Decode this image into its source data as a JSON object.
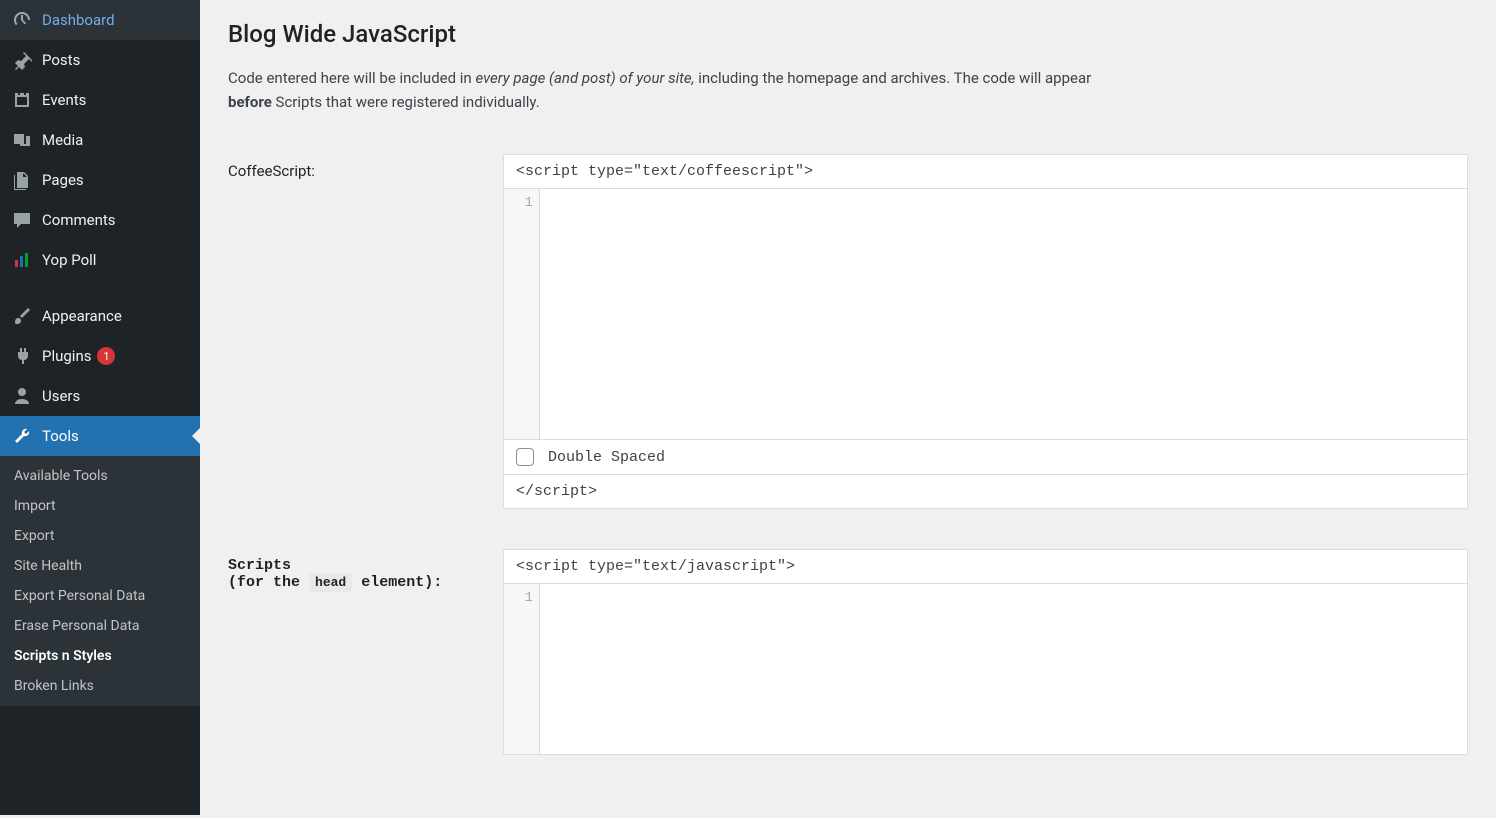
{
  "sidebar": {
    "items": [
      {
        "label": "Dashboard",
        "icon": "dashboard"
      },
      {
        "label": "Posts",
        "icon": "pin"
      },
      {
        "label": "Events",
        "icon": "calendar"
      },
      {
        "label": "Media",
        "icon": "media"
      },
      {
        "label": "Pages",
        "icon": "pages"
      },
      {
        "label": "Comments",
        "icon": "comment"
      },
      {
        "label": "Yop Poll",
        "icon": "bars"
      },
      {
        "label": "Appearance",
        "icon": "brush"
      },
      {
        "label": "Plugins",
        "icon": "plug",
        "badge": "1"
      },
      {
        "label": "Users",
        "icon": "user"
      },
      {
        "label": "Tools",
        "icon": "wrench",
        "active": true
      }
    ],
    "submenu": [
      {
        "label": "Available Tools"
      },
      {
        "label": "Import"
      },
      {
        "label": "Export"
      },
      {
        "label": "Site Health"
      },
      {
        "label": "Export Personal Data"
      },
      {
        "label": "Erase Personal Data"
      },
      {
        "label": "Scripts n Styles",
        "current": true
      },
      {
        "label": "Broken Links"
      }
    ]
  },
  "page": {
    "title": "Blog Wide JavaScript",
    "desc_pre": "Code entered here will be included in ",
    "desc_em": "every page (and post) of your site,",
    "desc_mid": " including the homepage and archives. The code will appear ",
    "desc_strong": "before",
    "desc_post": " Scripts that were registered individually."
  },
  "sections": {
    "coffeescript": {
      "label": "CoffeeScript:",
      "open_tag": "<script type=\"text/coffeescript\">",
      "close_tag": "</script>",
      "line1": "1",
      "checkbox_label": "Double Spaced"
    },
    "scripts": {
      "label_line1": "Scripts",
      "label_line2_pre": "(for the ",
      "label_line2_code": "head",
      "label_line2_post": " element):",
      "open_tag": "<script type=\"text/javascript\">",
      "line1": "1"
    }
  }
}
